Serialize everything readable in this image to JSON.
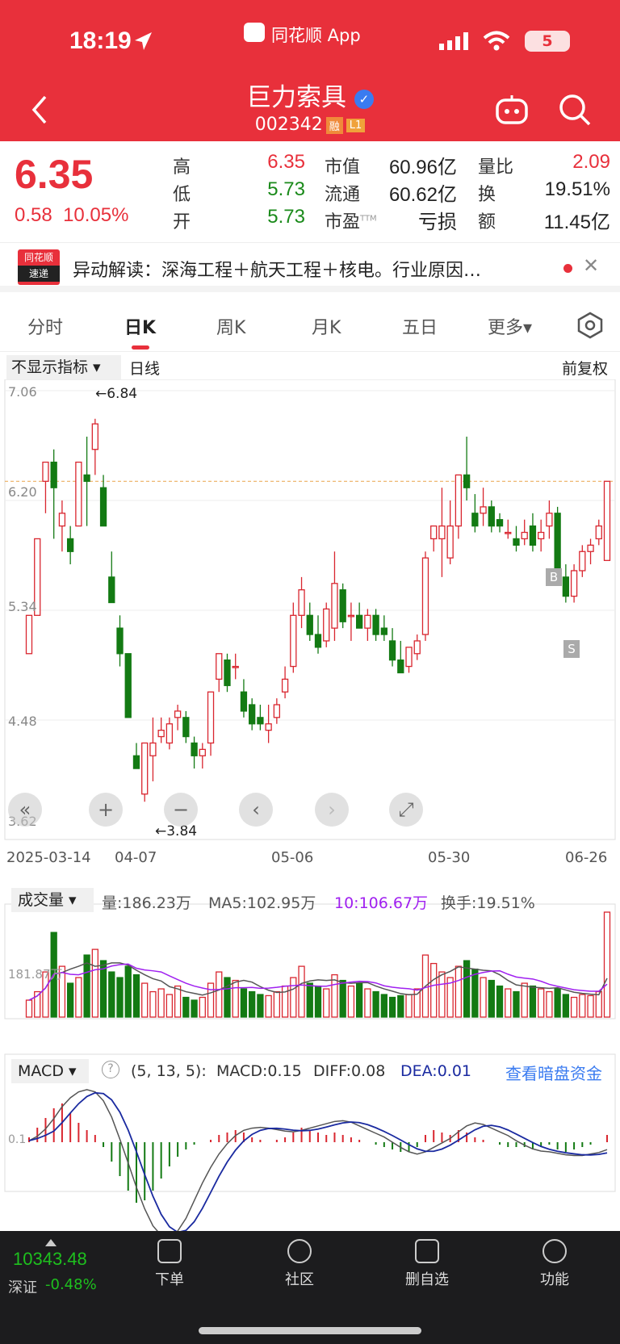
{
  "status_bar": {
    "time": "18:19",
    "app": "同花顺 App",
    "battery": "5"
  },
  "header": {
    "stock_name": "巨力索具",
    "stock_code": "002342",
    "tag_margin": "融",
    "tag_level": "L1"
  },
  "quote": {
    "price": "6.35",
    "change": "0.58",
    "change_pct": "10.05%",
    "labels": {
      "high": "高",
      "low": "低",
      "open": "开",
      "mcap": "市值",
      "float": "流通",
      "pe": "市盈",
      "pe_sup": "TTM",
      "vr": "量比",
      "turnover": "换",
      "amount": "额"
    },
    "values": {
      "high": "6.35",
      "low": "5.73",
      "open": "5.73",
      "mcap": "60.96亿",
      "float": "60.62亿",
      "pe": "亏损",
      "vr": "2.09",
      "turnover": "19.51%",
      "amount": "11.45亿"
    }
  },
  "news": {
    "brand_top": "同花顺",
    "brand_bottom": "速递",
    "text": "异动解读：深海工程＋航天工程＋核电。行业原因…"
  },
  "tabs": [
    "分时",
    "日K",
    "周K",
    "月K",
    "五日",
    "更多▾"
  ],
  "active_tab": "日K",
  "kline": {
    "indicator_select": "不显示指标 ▾",
    "period": "日线",
    "adjust": "前复权",
    "y_ticks": [
      "7.06",
      "6.20",
      "5.34",
      "4.48",
      "3.62"
    ],
    "x_ticks": [
      "2025-03-14",
      "04-07",
      "05-06",
      "05-30",
      "06-26"
    ],
    "high_note": "←6.84",
    "low_note": "←3.84",
    "buy_mark": "B",
    "sell_mark": "S"
  },
  "volume": {
    "select": "成交量 ▾",
    "vol": "量:186.23万",
    "ma5": "MA5:102.95万",
    "ma10": "10:106.67万",
    "turnover": "换手:19.51%",
    "y_tick": "181.87万"
  },
  "macd": {
    "select": "MACD ▾",
    "help": "?",
    "params": "(5, 13, 5):",
    "macd": "MACD:0.15",
    "diff": "DIFF:0.08",
    "dea": "DEA:0.01",
    "link": "查看暗盘资金",
    "zero": "0.1"
  },
  "bottom": {
    "index_value": "10343.48",
    "index_name": "深证",
    "index_change": "-0.48%",
    "nav": [
      "下单",
      "社区",
      "删自选",
      "功能"
    ]
  },
  "chart_data": {
    "type": "candlestick",
    "ylim": [
      3.62,
      7.06
    ],
    "ohlc": [
      [
        5.0,
        5.3,
        5.0,
        5.3
      ],
      [
        5.3,
        5.9,
        5.3,
        5.9
      ],
      [
        6.35,
        6.5,
        6.1,
        6.5
      ],
      [
        6.5,
        6.6,
        5.9,
        6.3
      ],
      [
        6.0,
        6.2,
        5.8,
        6.1
      ],
      [
        5.9,
        6.0,
        5.7,
        5.8
      ],
      [
        6.0,
        6.5,
        6.0,
        6.5
      ],
      [
        6.4,
        6.7,
        6.0,
        6.35
      ],
      [
        6.6,
        6.84,
        6.4,
        6.8
      ],
      [
        6.3,
        6.4,
        6.0,
        6.0
      ],
      [
        5.6,
        5.8,
        5.4,
        5.4
      ],
      [
        5.2,
        5.3,
        4.9,
        5.0
      ],
      [
        5.0,
        5.0,
        4.5,
        4.5
      ],
      [
        4.2,
        4.3,
        4.1,
        4.1
      ],
      [
        3.9,
        4.3,
        3.84,
        4.3
      ],
      [
        4.2,
        4.5,
        4.0,
        4.3
      ],
      [
        4.35,
        4.5,
        4.3,
        4.4
      ],
      [
        4.3,
        4.5,
        4.25,
        4.45
      ],
      [
        4.5,
        4.6,
        4.4,
        4.55
      ],
      [
        4.5,
        4.55,
        4.3,
        4.35
      ],
      [
        4.3,
        4.35,
        4.1,
        4.2
      ],
      [
        4.2,
        4.3,
        4.1,
        4.25
      ],
      [
        4.3,
        4.7,
        4.2,
        4.7
      ],
      [
        4.8,
        5.0,
        4.7,
        5.0
      ],
      [
        4.95,
        5.0,
        4.7,
        4.75
      ],
      [
        4.9,
        5.0,
        4.8,
        4.9
      ],
      [
        4.7,
        4.8,
        4.5,
        4.55
      ],
      [
        4.6,
        4.65,
        4.4,
        4.45
      ],
      [
        4.5,
        4.6,
        4.4,
        4.45
      ],
      [
        4.4,
        4.6,
        4.3,
        4.45
      ],
      [
        4.5,
        4.65,
        4.45,
        4.6
      ],
      [
        4.7,
        4.9,
        4.65,
        4.8
      ],
      [
        4.9,
        5.4,
        4.85,
        5.3
      ],
      [
        5.3,
        5.6,
        5.2,
        5.5
      ],
      [
        5.3,
        5.4,
        5.1,
        5.15
      ],
      [
        5.15,
        5.3,
        5.0,
        5.05
      ],
      [
        5.1,
        5.4,
        5.05,
        5.35
      ],
      [
        5.2,
        5.8,
        5.1,
        5.55
      ],
      [
        5.5,
        5.55,
        5.2,
        5.25
      ],
      [
        5.3,
        5.4,
        5.1,
        5.3
      ],
      [
        5.3,
        5.4,
        5.2,
        5.2
      ],
      [
        5.2,
        5.35,
        5.1,
        5.3
      ],
      [
        5.3,
        5.35,
        5.1,
        5.15
      ],
      [
        5.2,
        5.3,
        5.1,
        5.15
      ],
      [
        5.1,
        5.2,
        4.9,
        4.95
      ],
      [
        4.95,
        5.1,
        4.85,
        4.85
      ],
      [
        4.9,
        5.05,
        4.85,
        5.05
      ],
      [
        5.0,
        5.15,
        4.95,
        5.1
      ],
      [
        5.15,
        5.8,
        5.1,
        5.75
      ],
      [
        5.9,
        6.0,
        5.8,
        6.0
      ],
      [
        5.9,
        6.3,
        5.6,
        6.0
      ],
      [
        5.75,
        6.2,
        5.7,
        6.0
      ],
      [
        6.0,
        6.4,
        5.9,
        6.4
      ],
      [
        6.4,
        6.7,
        6.2,
        6.3
      ],
      [
        6.1,
        6.25,
        5.95,
        6.0
      ],
      [
        6.1,
        6.3,
        6.0,
        6.15
      ],
      [
        6.15,
        6.2,
        5.95,
        6.0
      ],
      [
        6.05,
        6.1,
        5.95,
        6.0
      ],
      [
        5.95,
        6.05,
        5.9,
        5.95
      ],
      [
        5.9,
        6.0,
        5.8,
        5.85
      ],
      [
        5.9,
        6.05,
        5.85,
        5.95
      ],
      [
        6.0,
        6.1,
        5.8,
        5.85
      ],
      [
        5.9,
        6.05,
        5.8,
        5.95
      ],
      [
        6.0,
        6.2,
        5.9,
        6.1
      ],
      [
        6.1,
        6.15,
        5.6,
        5.65
      ],
      [
        5.6,
        5.7,
        5.4,
        5.45
      ],
      [
        5.45,
        5.7,
        5.4,
        5.65
      ],
      [
        5.65,
        5.85,
        5.6,
        5.8
      ],
      [
        5.8,
        5.9,
        5.7,
        5.85
      ],
      [
        5.9,
        6.05,
        5.85,
        6.0
      ],
      [
        5.73,
        6.35,
        5.73,
        6.35
      ]
    ],
    "volume": [
      30,
      45,
      80,
      150,
      90,
      60,
      70,
      110,
      120,
      100,
      80,
      70,
      90,
      75,
      60,
      45,
      50,
      40,
      55,
      35,
      30,
      35,
      60,
      80,
      70,
      65,
      50,
      45,
      40,
      38,
      45,
      55,
      70,
      90,
      60,
      55,
      50,
      75,
      65,
      55,
      60,
      50,
      45,
      40,
      35,
      38,
      40,
      50,
      110,
      95,
      80,
      70,
      90,
      100,
      85,
      70,
      65,
      55,
      50,
      45,
      60,
      55,
      50,
      45,
      50,
      40,
      35,
      40,
      38,
      45,
      186
    ],
    "macd_hist": [
      0.02,
      0.06,
      0.1,
      0.14,
      0.16,
      0.12,
      0.08,
      0.05,
      0.03,
      -0.02,
      -0.08,
      -0.14,
      -0.2,
      -0.25,
      -0.24,
      -0.2,
      -0.15,
      -0.1,
      -0.06,
      -0.03,
      -0.01,
      0.0,
      0.01,
      0.03,
      0.04,
      0.05,
      0.04,
      0.02,
      0.01,
      0.0,
      0.01,
      0.02,
      0.04,
      0.06,
      0.05,
      0.04,
      0.03,
      0.04,
      0.03,
      0.02,
      0.01,
      0.0,
      -0.01,
      -0.02,
      -0.03,
      -0.04,
      -0.04,
      -0.02,
      0.03,
      0.05,
      0.04,
      0.03,
      0.05,
      0.04,
      0.02,
      0.01,
      0.0,
      -0.01,
      -0.02,
      -0.02,
      -0.02,
      -0.03,
      -0.02,
      -0.01,
      -0.03,
      -0.04,
      -0.03,
      -0.02,
      -0.01,
      0.0,
      0.03
    ]
  }
}
